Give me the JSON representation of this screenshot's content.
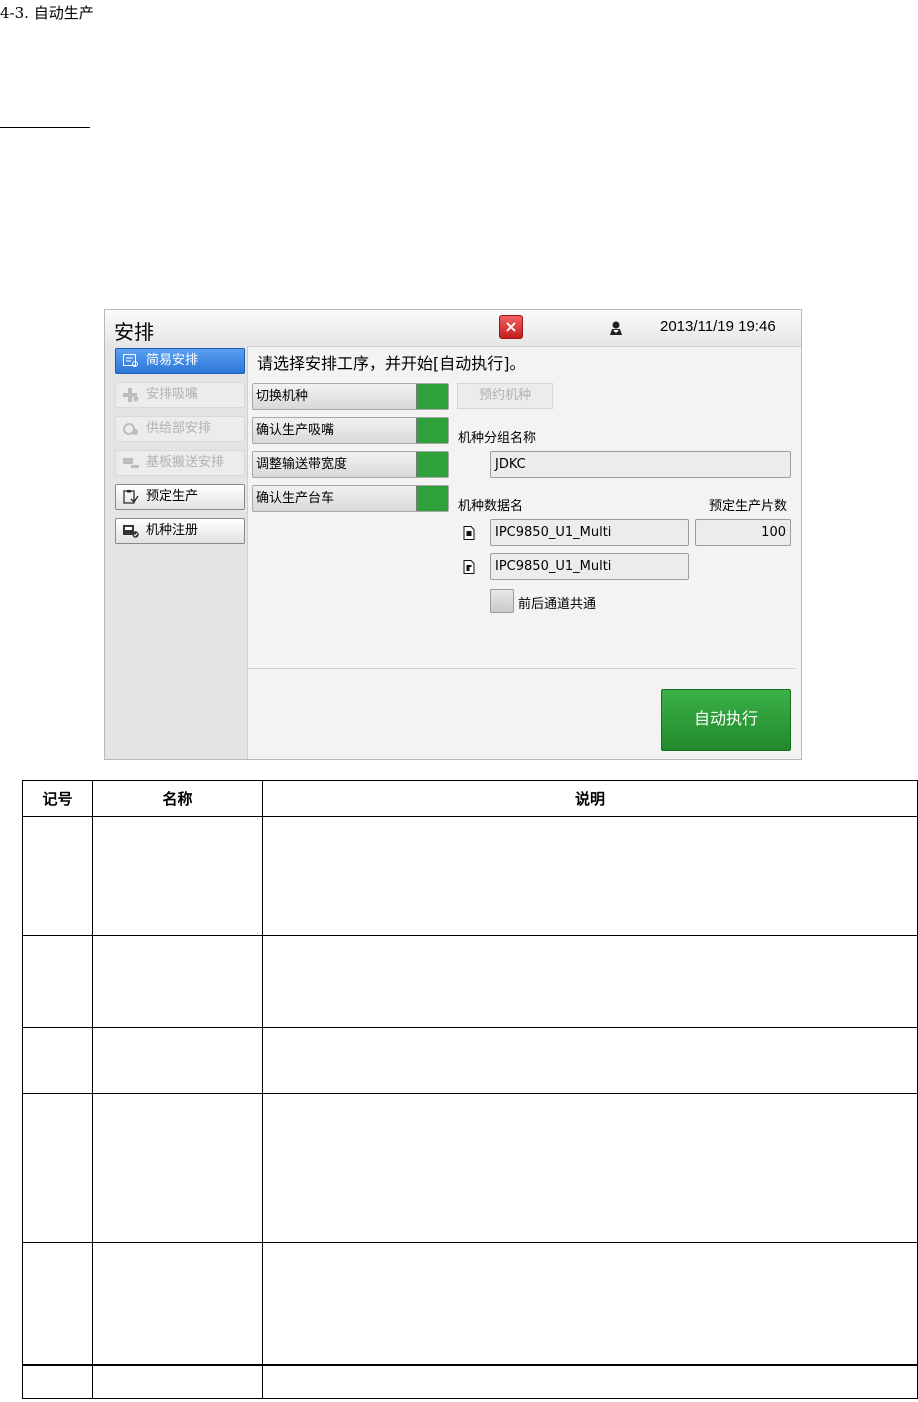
{
  "section_heading": "4-3. 自动生产",
  "screen": {
    "title": "安排",
    "close_glyph": "×",
    "datetime": "2013/11/19 19:46",
    "sidebar": [
      {
        "label": "简易安排",
        "state": "active",
        "icon": "list-search-icon"
      },
      {
        "label": "安排吸嘴",
        "state": "disabled",
        "icon": "add-nozzle-icon"
      },
      {
        "label": "供给部安排",
        "state": "disabled",
        "icon": "feeder-icon"
      },
      {
        "label": "基板搬送安排",
        "state": "disabled",
        "icon": "board-transfer-icon"
      },
      {
        "label": "预定生产",
        "state": "normal",
        "icon": "clipboard-icon"
      },
      {
        "label": "机种注册",
        "state": "normal",
        "icon": "register-icon"
      }
    ],
    "bottom_buttons": [
      "double-chevron-up-icon",
      "warning-icon",
      "info-icon"
    ],
    "instruction": "请选择安排工序，并开始[自动执行]。",
    "steps": [
      {
        "label": "切换机种",
        "status_color": "#2fa13a"
      },
      {
        "label": "确认生产吸嘴",
        "status_color": "#2fa13a"
      },
      {
        "label": "调整输送带宽度",
        "status_color": "#2fa13a"
      },
      {
        "label": "确认生产台车",
        "status_color": "#2fa13a"
      }
    ],
    "reserve_button": "预约机种",
    "group_label": "机种分组名称",
    "group_value": "JDKC",
    "data_name_label": "机种数据名",
    "planned_count_label": "预定生产片数",
    "data_name_front": "IPC9850_U1_Multi",
    "data_name_rear": "IPC9850_U1_Multi",
    "planned_count": "100",
    "common_lane_label": "前后通道共通",
    "auto_button": "自动执行"
  },
  "table": {
    "headers": [
      "记号",
      "名称",
      "说明"
    ],
    "rows": [
      [
        "",
        "",
        ""
      ],
      [
        "",
        "",
        ""
      ],
      [
        "",
        "",
        ""
      ],
      [
        "",
        "",
        ""
      ],
      [
        "",
        "",
        ""
      ],
      [
        "",
        "",
        ""
      ]
    ]
  },
  "colors": {
    "active_blue": "#2b76d6",
    "status_green": "#2fa13a",
    "close_red": "#d62a2a"
  }
}
